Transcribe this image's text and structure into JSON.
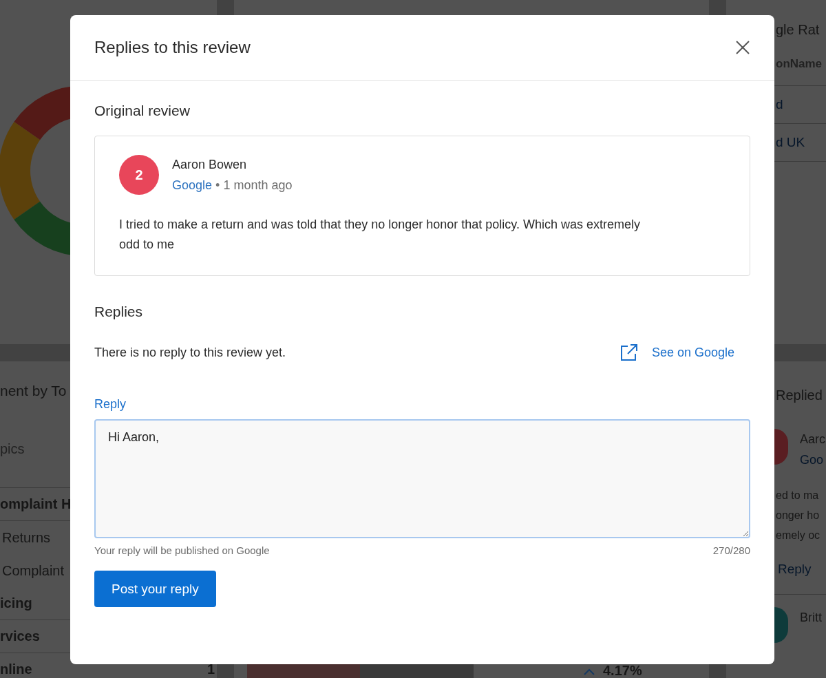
{
  "dashboard": {
    "topic_panel": {
      "title": "nent by To",
      "column_header": "pics",
      "rows": [
        {
          "kind": "group",
          "label": "omplaint H"
        },
        {
          "kind": "item",
          "label": "Returns"
        },
        {
          "kind": "item",
          "label": "Complaint"
        },
        {
          "kind": "group",
          "label": "icing"
        },
        {
          "kind": "group",
          "label": "rvices"
        },
        {
          "kind": "group",
          "label": "nline",
          "count": "1"
        }
      ]
    },
    "trend": {
      "change": "4.17%"
    },
    "ratings_panel": {
      "title": "gle Rat",
      "column_header": "onName",
      "rows": [
        "d",
        "d UK"
      ]
    },
    "replied_panel": {
      "title": "Replied",
      "reviews": [
        {
          "name": "Aarc",
          "source": "Goo",
          "color": "#5a1e22",
          "text_lines": [
            "ed to ma",
            "onger ho",
            "emely oc"
          ],
          "action": "Reply"
        },
        {
          "name": "Britt",
          "color": "#0e3b3b"
        }
      ]
    }
  },
  "dialog": {
    "title": "Replies to this review",
    "original_heading": "Original review",
    "review": {
      "rating": "2",
      "name": "Aaron Bowen",
      "source": "Google",
      "separator": "•",
      "age": "1 month ago",
      "text": "I tried to make a return and was told that they no longer honor that policy. Which was extremely odd to me"
    },
    "replies_heading": "Replies",
    "empty_text": "There is no reply to this review yet.",
    "external_link": "See on Google",
    "reply_label": "Reply",
    "reply_value": "Hi Aaron, ",
    "hint": "Your reply will be published on Google",
    "counter": "270/280",
    "submit": "Post your reply"
  }
}
